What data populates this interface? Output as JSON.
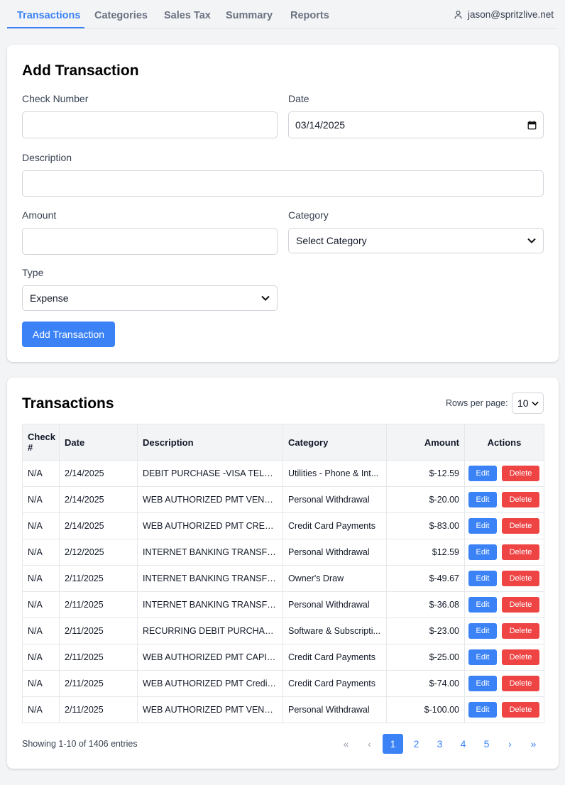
{
  "nav": {
    "tabs": [
      {
        "label": "Transactions"
      },
      {
        "label": "Categories"
      },
      {
        "label": "Sales Tax"
      },
      {
        "label": "Summary"
      },
      {
        "label": "Reports"
      }
    ],
    "active_tab": "Transactions",
    "user_email": "jason@spritzlive.net"
  },
  "add_form": {
    "title": "Add Transaction",
    "check_number_label": "Check Number",
    "check_number_value": "",
    "date_label": "Date",
    "date_value": "03/14/2025",
    "description_label": "Description",
    "description_value": "",
    "amount_label": "Amount",
    "amount_value": "",
    "category_label": "Category",
    "category_value": "Select Category",
    "type_label": "Type",
    "type_value": "Expense",
    "submit_label": "Add Transaction"
  },
  "list": {
    "title": "Transactions",
    "rows_per_page_label": "Rows per page:",
    "rows_per_page_value": "10",
    "columns": [
      "Check #",
      "Date",
      "Description",
      "Category",
      "Amount",
      "Actions"
    ],
    "edit_label": "Edit",
    "delete_label": "Delete",
    "rows": [
      {
        "check": "N/A",
        "date": "2/14/2025",
        "description": "DEBIT PURCHASE -VISA TELLO ...",
        "category": "Utilities - Phone & Int...",
        "amount": "$-12.59"
      },
      {
        "check": "N/A",
        "date": "2/14/2025",
        "description": "WEB AUTHORIZED PMT VENMO",
        "category": "Personal Withdrawal",
        "amount": "$-20.00"
      },
      {
        "check": "N/A",
        "date": "2/14/2025",
        "description": "WEB AUTHORIZED PMT CREDIT ...",
        "category": "Credit Card Payments",
        "amount": "$-83.00"
      },
      {
        "check": "N/A",
        "date": "2/12/2025",
        "description": "INTERNET BANKING TRANSFER ...",
        "category": "Personal Withdrawal",
        "amount": "$12.59"
      },
      {
        "check": "N/A",
        "date": "2/11/2025",
        "description": "INTERNET BANKING TRANSFER ...",
        "category": "Owner's Draw",
        "amount": "$-49.67"
      },
      {
        "check": "N/A",
        "date": "2/11/2025",
        "description": "INTERNET BANKING TRANSFER ...",
        "category": "Personal Withdrawal",
        "amount": "$-36.08"
      },
      {
        "check": "N/A",
        "date": "2/11/2025",
        "description": "RECURRING DEBIT PURCHASE ...",
        "category": "Software & Subscripti...",
        "amount": "$-23.00"
      },
      {
        "check": "N/A",
        "date": "2/11/2025",
        "description": "WEB AUTHORIZED PMT CAPITA...",
        "category": "Credit Card Payments",
        "amount": "$-25.00"
      },
      {
        "check": "N/A",
        "date": "2/11/2025",
        "description": "WEB AUTHORIZED PMT Credit ...",
        "category": "Credit Card Payments",
        "amount": "$-74.00"
      },
      {
        "check": "N/A",
        "date": "2/11/2025",
        "description": "WEB AUTHORIZED PMT VENMO",
        "category": "Personal Withdrawal",
        "amount": "$-100.00"
      }
    ],
    "showing_text": "Showing 1-10 of 1406 entries",
    "pagination": {
      "first": "«",
      "prev": "‹",
      "pages": [
        "1",
        "2",
        "3",
        "4",
        "5"
      ],
      "current": "1",
      "next": "›",
      "last": "»"
    }
  },
  "colors": {
    "accent": "#3b82f6",
    "danger": "#ef4444",
    "background": "#f3f4f6"
  }
}
